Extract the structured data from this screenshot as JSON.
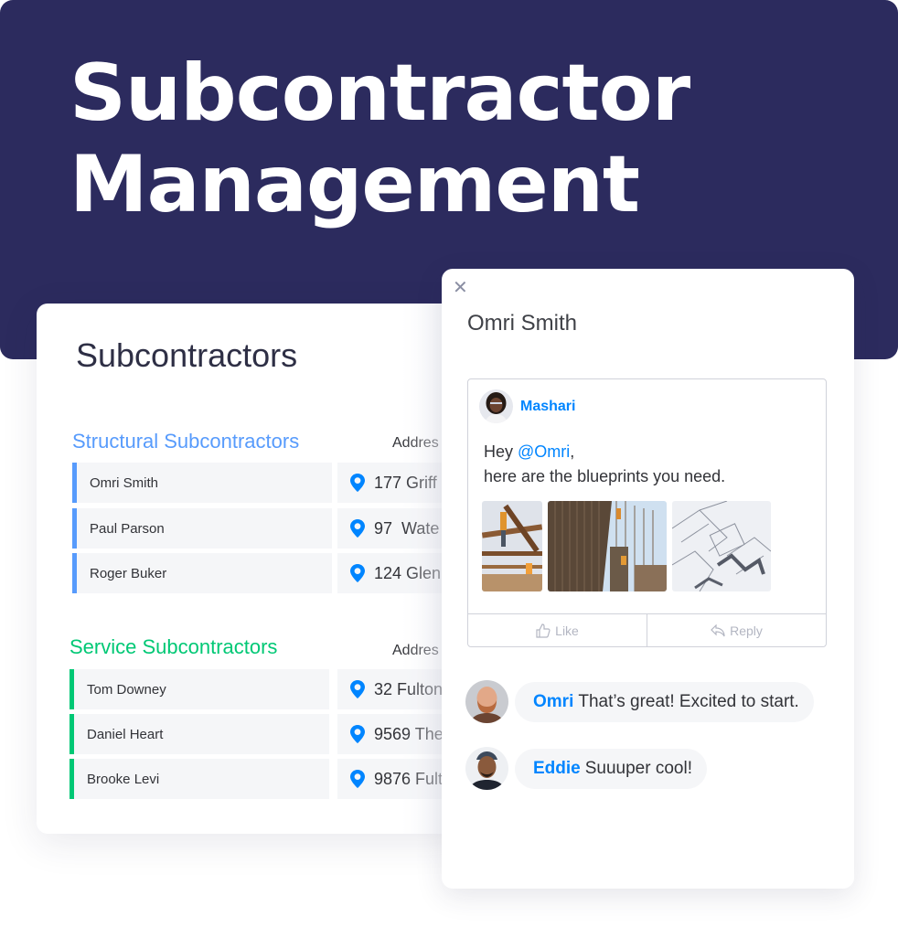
{
  "hero": {
    "line1": "Subcontractor",
    "line2": "Management",
    "background_color": "#2c2b5e"
  },
  "board": {
    "title": "Subcontractors",
    "groups": [
      {
        "title": "Structural Subcontractors",
        "color": "#579bfc",
        "address_header": "Addres",
        "rows": [
          {
            "name": "Omri Smith",
            "address": "177 Griff"
          },
          {
            "name": "Paul Parson",
            "address": "97  Wate"
          },
          {
            "name": "Roger Buker",
            "address": "124 Glen"
          }
        ]
      },
      {
        "title": "Service Subcontractors",
        "color": "#00c875",
        "address_header": "Addres",
        "rows": [
          {
            "name": "Tom Downey",
            "address": "32 Fulton"
          },
          {
            "name": "Daniel Heart",
            "address": "9569 The"
          },
          {
            "name": "Brooke Levi",
            "address": "9876 Fult"
          }
        ]
      }
    ]
  },
  "panel": {
    "close_icon": "close-icon",
    "title": "Omri Smith",
    "post": {
      "author": "Mashari",
      "greeting": "Hey ",
      "mention": "@Omri",
      "greeting_end": ",",
      "body": "here are the blueprints you need.",
      "images": [
        "construction-workers-photo",
        "rebar-construction-photo",
        "blueprint-photo"
      ],
      "like_label": "Like",
      "reply_label": "Reply"
    },
    "comments": [
      {
        "author": "Omri",
        "text": "That’s great! Excited to start."
      },
      {
        "author": "Eddie",
        "text": "Suuuper cool!"
      }
    ]
  },
  "colors": {
    "accent_blue": "#0085ff",
    "structural_blue": "#579bfc",
    "service_green": "#00c875"
  }
}
